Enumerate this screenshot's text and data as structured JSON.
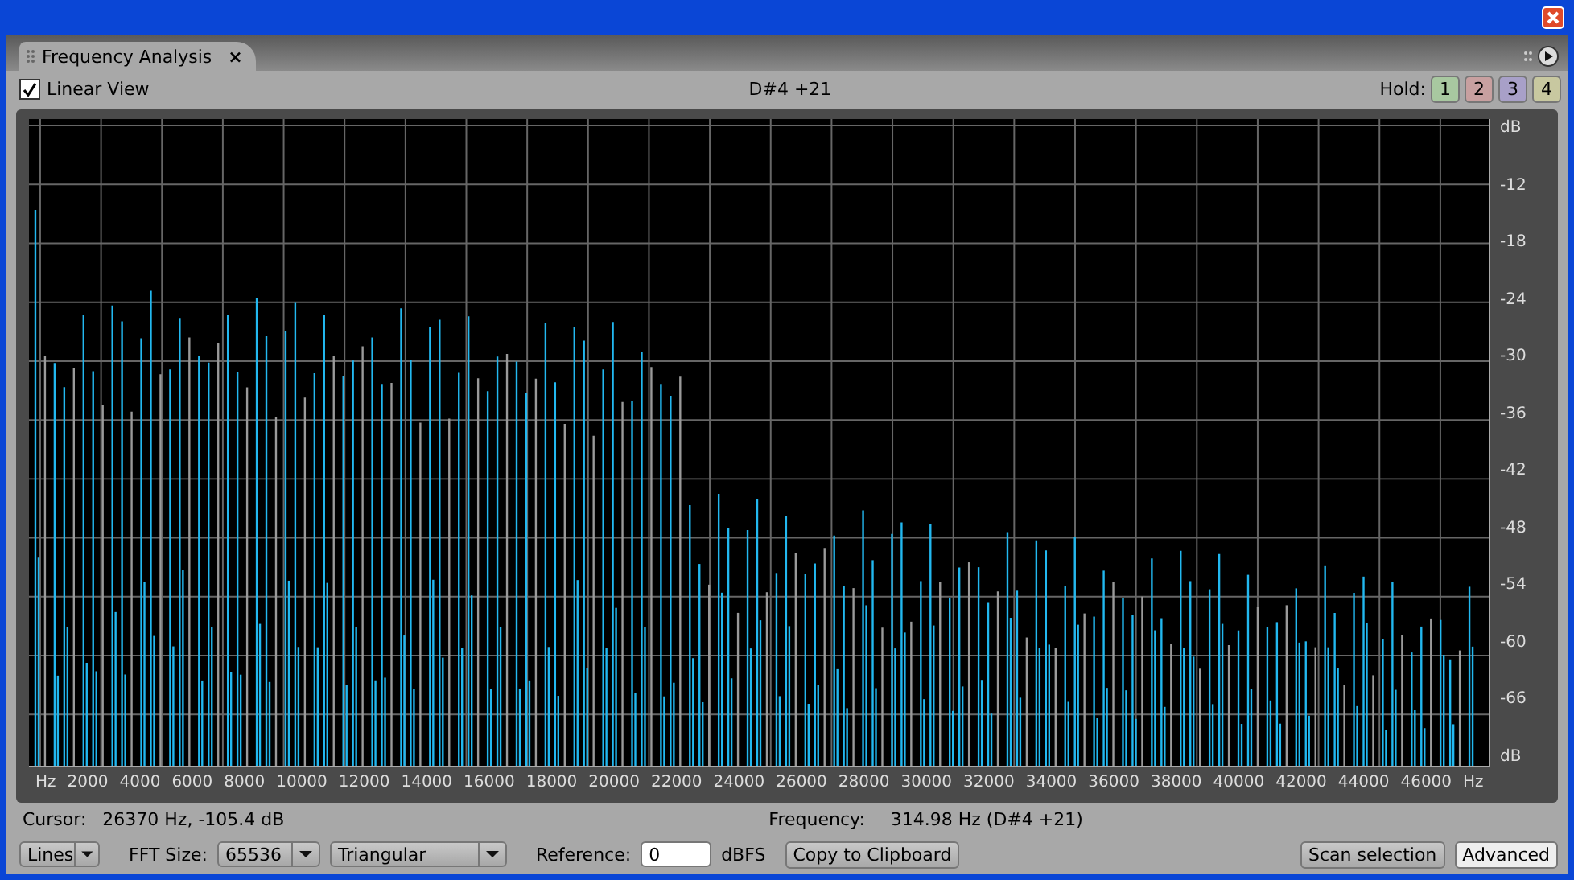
{
  "tab": {
    "label": "Frequency Analysis",
    "selected": true,
    "close": "×"
  },
  "toolbar": {
    "linear_view": {
      "label": "Linear View",
      "checked": true
    },
    "note": "D#4 +21",
    "hold_label": "Hold:",
    "hold_buttons": [
      {
        "label": "1",
        "color": "#a8c8a0"
      },
      {
        "label": "2",
        "color": "#c8a0a0"
      },
      {
        "label": "3",
        "color": "#a8a0c8"
      },
      {
        "label": "4",
        "color": "#c8c8a0"
      }
    ]
  },
  "plot": {
    "x_axis_labels": [
      "Hz",
      "2000",
      "4000",
      "6000",
      "8000",
      "10000",
      "12000",
      "14000",
      "16000",
      "18000",
      "20000",
      "22000",
      "24000",
      "26000",
      "28000",
      "30000",
      "32000",
      "34000",
      "36000",
      "38000",
      "40000",
      "42000",
      "44000",
      "46000",
      "Hz"
    ],
    "y_axis_labels": [
      "dB",
      "-12",
      "-18",
      "-24",
      "-30",
      "-36",
      "-42",
      "-48",
      "-54",
      "-60",
      "-66",
      "dB"
    ]
  },
  "status": {
    "cursor_label": "Cursor:",
    "cursor_value": "26370 Hz, -105.4 dB",
    "frequency_label": "Frequency:",
    "frequency_value": "314.98 Hz (D#4 +21)"
  },
  "controls": {
    "display": "Lines",
    "fft_label": "FFT Size:",
    "fft_size": "65536",
    "window": "Triangular",
    "reference_label": "Reference:",
    "reference_value": "0",
    "reference_unit": "dBFS",
    "copy_button": "Copy to Clipboard",
    "scan_button": "Scan selection",
    "advanced_button": {
      "label": "Advanced",
      "selected": true
    }
  }
}
